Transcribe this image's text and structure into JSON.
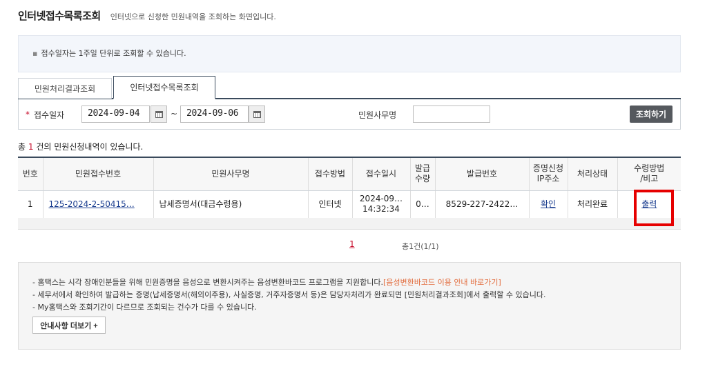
{
  "header": {
    "title": "인터넷접수목록조회",
    "description": "인터넷으로 신청한 민원내역을 조회하는 화면입니다."
  },
  "notice_top": "접수일자는 1주일 단위로 조회할 수 있습니다.",
  "tabs": [
    {
      "label": "민원처리결과조회",
      "active": false
    },
    {
      "label": "인터넷접수목록조회",
      "active": true
    }
  ],
  "search": {
    "date_label": "접수일자",
    "date_from": "2024-09-04",
    "date_to": "2024-09-06",
    "tilde": "~",
    "office_label": "민원사무명",
    "office_value": "",
    "button_label": "조회하기"
  },
  "count": {
    "prefix": "총",
    "num": "1",
    "suffix": "건의 민원신청내역이 있습니다."
  },
  "table": {
    "headers": [
      "번호",
      "민원접수번호",
      "민원사무명",
      "접수방법",
      "접수일시",
      "발급\n수량",
      "발급번호",
      "증명신청\nIP주소",
      "처리상태",
      "수령방법\n/비고"
    ],
    "rows": [
      {
        "no": "1",
        "receipt_no": "125-2024-2-50415…",
        "office": "납세증명서(대금수령용)",
        "method": "인터넷",
        "date_line1": "2024-09…",
        "date_line2": "14:32:34",
        "qty": "0…",
        "issue_no": "8529-227-2422…",
        "ip": "확인",
        "status": "처리완료",
        "receive": "출력"
      }
    ]
  },
  "pager": {
    "current": "1",
    "total": "총1건(1/1)"
  },
  "notice_bottom": {
    "line1": "- 홈택스는 시각 장애인분들을 위해 민원증명을 음성으로 변환시켜주는 음성변환바코드 프로그램을 지원합니다.",
    "line1_link": "[음성변환바코드 이용 안내 바로가기]",
    "line2": "- 세무서에서 확인하여 발급하는 증명(납세증명서(해외이주용), 사실증명, 거주자증명서 등)은 담당자처리가 완료되면 [민원처리결과조회]에서 출력할 수 있습니다.",
    "line3": "- My홈택스와 조회기간이 다르므로 조회되는 건수가 다를 수 있습니다.",
    "more_button": "안내사항 더보기 +"
  },
  "colors": {
    "accent_red": "#c8102e",
    "highlight": "#e60000",
    "link": "#1a3d8f",
    "link_orange": "#e26a3a"
  }
}
